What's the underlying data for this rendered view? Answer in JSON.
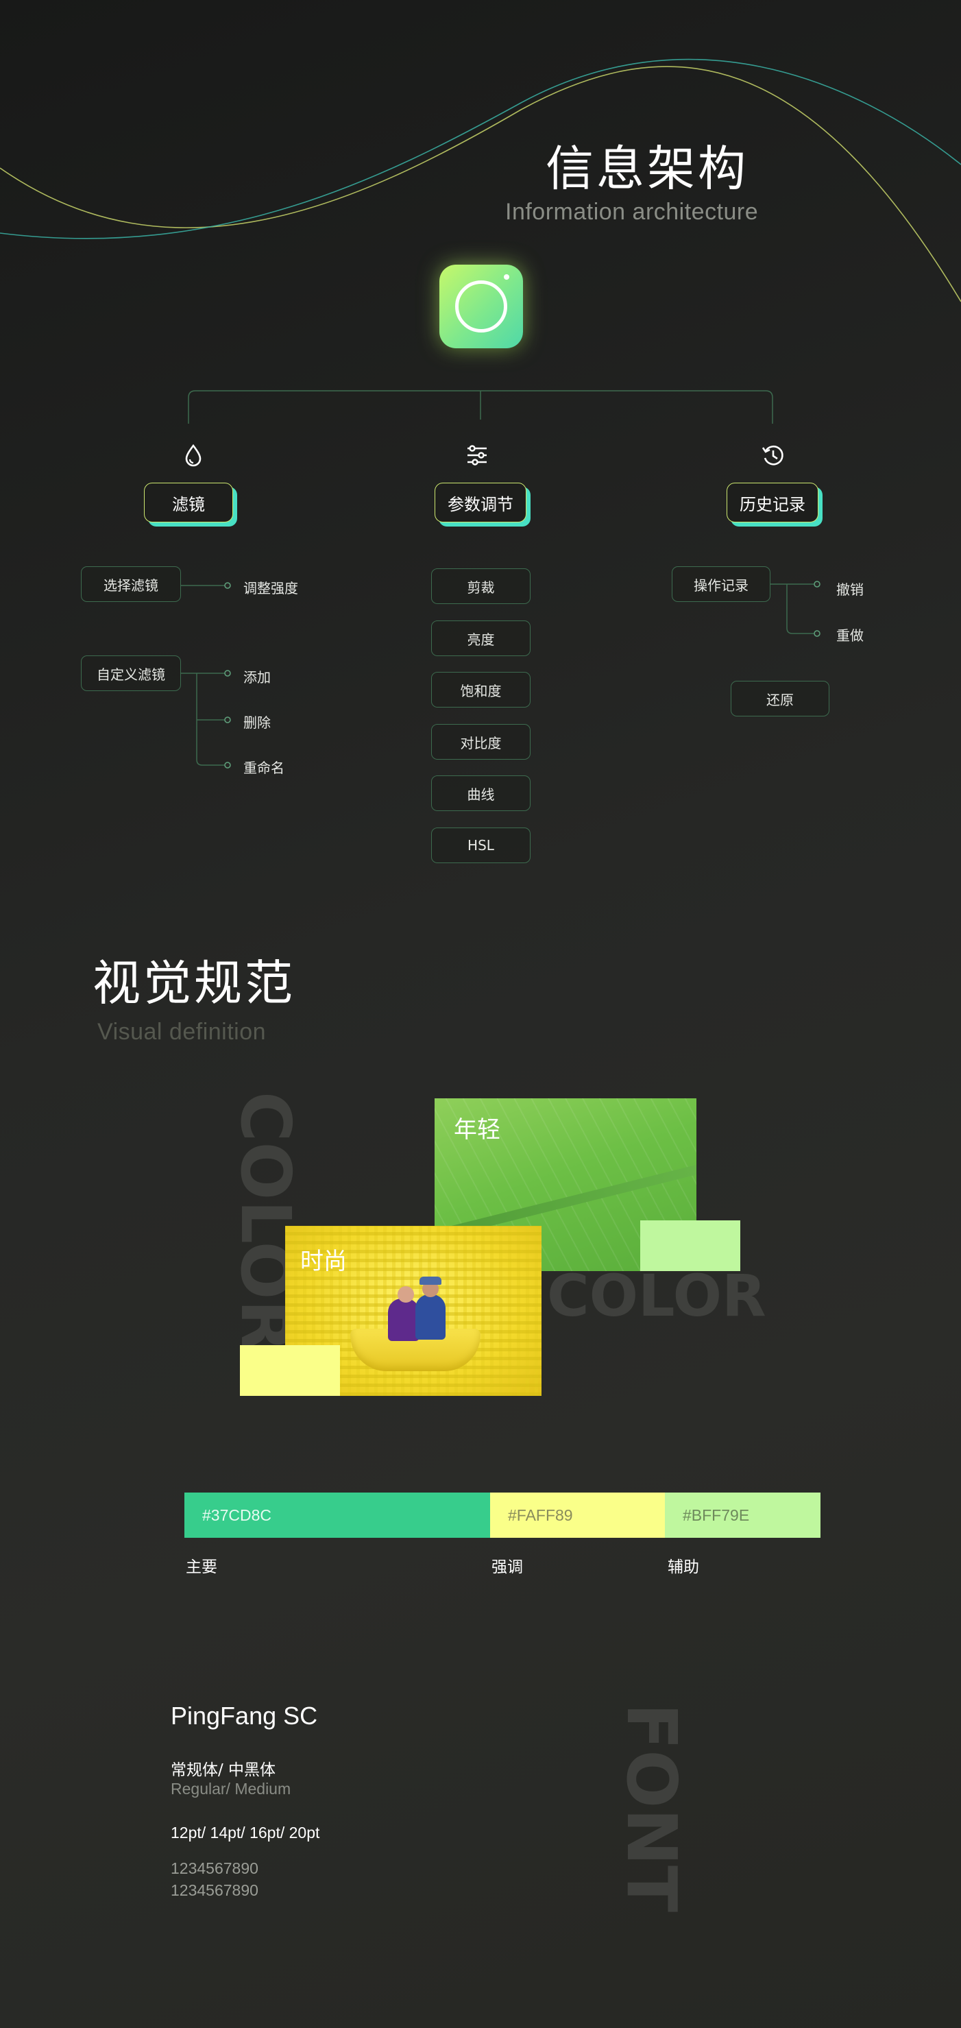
{
  "colors": {
    "primary": "#37CD8C",
    "accent": "#FAFF89",
    "secondary": "#BFF79E"
  },
  "info_arch": {
    "title_zh": "信息架构",
    "title_en": "Information architecture",
    "app_icon": "camera-lens-icon",
    "categories": [
      {
        "label": "滤镜",
        "icon": "drop-icon"
      },
      {
        "label": "参数调节",
        "icon": "sliders-icon"
      },
      {
        "label": "历史记录",
        "icon": "history-icon"
      }
    ],
    "filter": {
      "select": "选择滤镜",
      "select_child": "调整强度",
      "custom": "自定义滤镜",
      "custom_children": [
        "添加",
        "删除",
        "重命名"
      ]
    },
    "params": [
      "剪裁",
      "亮度",
      "饱和度",
      "对比度",
      "曲线",
      "HSL"
    ],
    "history": {
      "ops": "操作记录",
      "ops_children": [
        "撤销",
        "重做"
      ],
      "restore": "还原"
    }
  },
  "visual": {
    "title_zh": "视觉规范",
    "title_en": "Visual definition",
    "moodboard": {
      "caption_green": "年轻",
      "caption_yellow": "时尚",
      "watermark_vertical": "COLOR",
      "watermark_horizontal": "COLOR"
    },
    "palette": [
      {
        "hex": "#37CD8C",
        "label": "主要",
        "share": 0.48
      },
      {
        "hex": "#FAFF89",
        "label": "强调",
        "share": 0.275
      },
      {
        "hex": "#BFF79E",
        "label": "辅助",
        "share": 0.245
      }
    ],
    "font": {
      "family": "PingFang SC",
      "weights_zh": "常规体/ 中黑体",
      "weights_en": "Regular/ Medium",
      "sizes": "12pt/ 14pt/ 16pt/ 20pt",
      "sample_1": "1234567890",
      "sample_2": "1234567890",
      "watermark": "FONT"
    }
  }
}
